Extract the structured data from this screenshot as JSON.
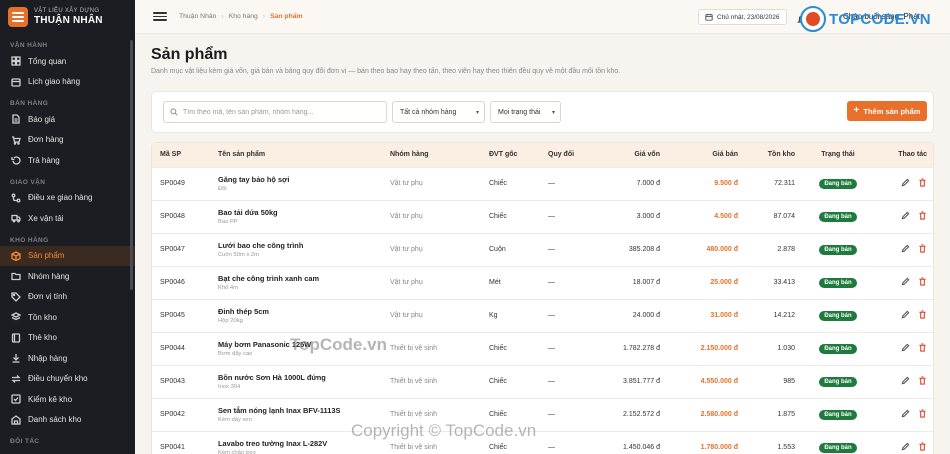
{
  "brand": {
    "subtitle": "VẬT LIỆU XÂY DỰNG",
    "name": "THUẬN NHÂN",
    "accent": "#e8702a"
  },
  "sidebar": {
    "sections": [
      {
        "title": "VẬN HÀNH",
        "items": [
          {
            "label": "Tổng quan",
            "icon": "grid-icon"
          },
          {
            "label": "Lịch giao hàng",
            "icon": "calendar-icon"
          }
        ]
      },
      {
        "title": "BÁN HÀNG",
        "items": [
          {
            "label": "Báo giá",
            "icon": "document-icon"
          },
          {
            "label": "Đơn hàng",
            "icon": "cart-icon"
          },
          {
            "label": "Trả hàng",
            "icon": "return-icon"
          }
        ]
      },
      {
        "title": "GIAO VẬN",
        "items": [
          {
            "label": "Điều xe giao hàng",
            "icon": "route-icon"
          },
          {
            "label": "Xe vận tải",
            "icon": "truck-icon"
          }
        ]
      },
      {
        "title": "KHO HÀNG",
        "items": [
          {
            "label": "Sản phẩm",
            "icon": "box-icon",
            "active": true
          },
          {
            "label": "Nhóm hàng",
            "icon": "folder-icon"
          },
          {
            "label": "Đơn vị tính",
            "icon": "tag-icon"
          },
          {
            "label": "Tồn kho",
            "icon": "layers-icon"
          },
          {
            "label": "Thẻ kho",
            "icon": "book-icon"
          },
          {
            "label": "Nhập hàng",
            "icon": "download-icon"
          },
          {
            "label": "Điều chuyển kho",
            "icon": "transfer-icon"
          },
          {
            "label": "Kiểm kê kho",
            "icon": "check-icon"
          },
          {
            "label": "Danh sách kho",
            "icon": "warehouse-icon"
          }
        ]
      },
      {
        "title": "ĐỐI TÁC",
        "items": []
      }
    ]
  },
  "topbar": {
    "breadcrumb": [
      "Thuận Nhân",
      "Kho hàng",
      "Sản phẩm"
    ],
    "date": "Chủ nhật, 23/08/2026",
    "greeting": "Chào buổi sáng, Phát"
  },
  "page": {
    "title": "Sản phẩm",
    "description": "Danh mục vật liệu kèm giá vốn, giá bán và bảng quy đổi đơn vị — bán theo bao hay theo tấn, theo viên hay theo thiên đều quy về một đầu mối tồn kho."
  },
  "filters": {
    "search_placeholder": "Tìm theo mã, tên sản phẩm, nhóm hàng...",
    "group_select": "Tất cả nhóm hàng",
    "status_select": "Mọi trạng thái",
    "add_button": "Thêm sản phẩm"
  },
  "table": {
    "headers": [
      "Mã SP",
      "Tên sản phẩm",
      "Nhóm hàng",
      "ĐVT gốc",
      "Quy đổi",
      "Giá vốn",
      "Giá bán",
      "Tồn kho",
      "Trạng thái",
      "Thao tác"
    ],
    "rows": [
      {
        "code": "SP0049",
        "name": "Găng tay bảo hộ sợi",
        "sub": "Đôi",
        "group": "Vật tư phụ",
        "unit": "Chiếc",
        "conv": "—",
        "cost": "7.000 đ",
        "price": "9.500 đ",
        "stock": "72.311",
        "status": "Đang bán"
      },
      {
        "code": "SP0048",
        "name": "Bao tải dứa 50kg",
        "sub": "Bao PP",
        "group": "Vật tư phụ",
        "unit": "Chiếc",
        "conv": "—",
        "cost": "3.000 đ",
        "price": "4.500 đ",
        "stock": "87.074",
        "status": "Đang bán"
      },
      {
        "code": "SP0047",
        "name": "Lưới bao che công trình",
        "sub": "Cuộn 50m x 2m",
        "group": "Vật tư phụ",
        "unit": "Cuộn",
        "conv": "—",
        "cost": "385.208 đ",
        "price": "480.000 đ",
        "stock": "2.878",
        "status": "Đang bán"
      },
      {
        "code": "SP0046",
        "name": "Bạt che công trình xanh cam",
        "sub": "Khổ 4m",
        "group": "Vật tư phụ",
        "unit": "Mét",
        "conv": "—",
        "cost": "18.007 đ",
        "price": "25.000 đ",
        "stock": "33.413",
        "status": "Đang bán"
      },
      {
        "code": "SP0045",
        "name": "Đinh thép 5cm",
        "sub": "Hộp 20kg",
        "group": "Vật tư phụ",
        "unit": "Kg",
        "conv": "—",
        "cost": "24.000 đ",
        "price": "31.000 đ",
        "stock": "14.212",
        "status": "Đang bán"
      },
      {
        "code": "SP0044",
        "name": "Máy bơm Panasonic 125W",
        "sub": "Bơm đẩy cao",
        "group": "Thiết bị vệ sinh",
        "unit": "Chiếc",
        "conv": "—",
        "cost": "1.782.278 đ",
        "price": "2.150.000 đ",
        "stock": "1.030",
        "status": "Đang bán"
      },
      {
        "code": "SP0043",
        "name": "Bồn nước Sơn Hà 1000L đứng",
        "sub": "Inox 304",
        "group": "Thiết bị vệ sinh",
        "unit": "Chiếc",
        "conv": "—",
        "cost": "3.851.777 đ",
        "price": "4.550.000 đ",
        "stock": "985",
        "status": "Đang bán"
      },
      {
        "code": "SP0042",
        "name": "Sen tắm nóng lạnh Inax BFV-1113S",
        "sub": "Kèm dây sen",
        "group": "Thiết bị vệ sinh",
        "unit": "Chiếc",
        "conv": "—",
        "cost": "2.152.572 đ",
        "price": "2.580.000 đ",
        "stock": "1.875",
        "status": "Đang bán"
      },
      {
        "code": "SP0041",
        "name": "Lavabo treo tường Inax L-282V",
        "sub": "Kèm chân treo",
        "group": "Thiết bị vệ sinh",
        "unit": "Chiếc",
        "conv": "—",
        "cost": "1.450.046 đ",
        "price": "1.780.000 đ",
        "stock": "1.553",
        "status": "Đang bán"
      }
    ]
  },
  "watermarks": {
    "logo_text": "TOPCODE.VN",
    "center_text": "TopCode.vn",
    "copyright_text": "Copyright © TopCode.vn"
  }
}
